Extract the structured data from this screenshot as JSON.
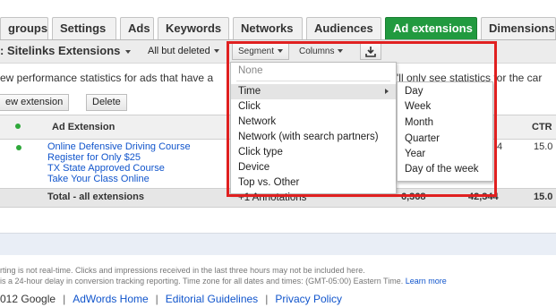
{
  "tabs": [
    {
      "label": "groups",
      "active": false
    },
    {
      "label": "Settings",
      "active": false
    },
    {
      "label": "Ads",
      "active": false
    },
    {
      "label": "Keywords",
      "active": false
    },
    {
      "label": "Networks",
      "active": false
    },
    {
      "label": "Audiences",
      "active": false
    },
    {
      "label": "Ad extensions",
      "active": true
    },
    {
      "label": "Dimensions",
      "active": false
    }
  ],
  "toolbar": {
    "title": ": Sitelinks Extensions",
    "filter": "All but deleted",
    "segment_label": "Segment",
    "columns_label": "Columns",
    "download_icon": "download-icon"
  },
  "info": {
    "performance_text": "ew performance statistics for ads that have a",
    "performance_tail": "'ll only see statistics for the car"
  },
  "actions": {
    "new_extension": "ew extension",
    "delete": "Delete"
  },
  "table": {
    "headers": {
      "ad_extension": "Ad Extension",
      "ctr": "CTR"
    },
    "row": {
      "lines": [
        "Online Defensive Driving Course",
        "Register for Only $25",
        "TX State Approved Course",
        "Take Your Class Online"
      ],
      "partial_value": "4",
      "ctr": "15.0"
    },
    "totals": {
      "label": "Total - all extensions",
      "v1": "6,368",
      "v2": "42,344",
      "ctr": "15.0"
    }
  },
  "segment_menu": {
    "items": [
      {
        "label": "None",
        "disabled": true
      },
      {
        "label": "Time",
        "submenu": true,
        "hover": true
      },
      {
        "label": "Click"
      },
      {
        "label": "Network"
      },
      {
        "label": "Network (with search partners)"
      },
      {
        "label": "Click type"
      },
      {
        "label": "Device"
      },
      {
        "label": "Top vs. Other"
      },
      {
        "label": "+1 Annotations"
      }
    ]
  },
  "time_submenu": {
    "items": [
      "Day",
      "Week",
      "Month",
      "Quarter",
      "Year",
      "Day of the week"
    ]
  },
  "footnotes": {
    "line1": "rting is not real-time. Clicks and impressions received in the last three hours may not be included here.",
    "line2": "is a 24-hour delay in conversion tracking reporting. Time zone for all dates and times: (GMT-05:00) Eastern Time.",
    "learn_more": "Learn more"
  },
  "footer": {
    "copyright": "012 Google",
    "links": [
      "AdWords Home",
      "Editorial Guidelines",
      "Privacy Policy"
    ]
  },
  "colors": {
    "active_tab": "#219a3f",
    "highlight": "#e02020",
    "link": "#1155cc"
  }
}
